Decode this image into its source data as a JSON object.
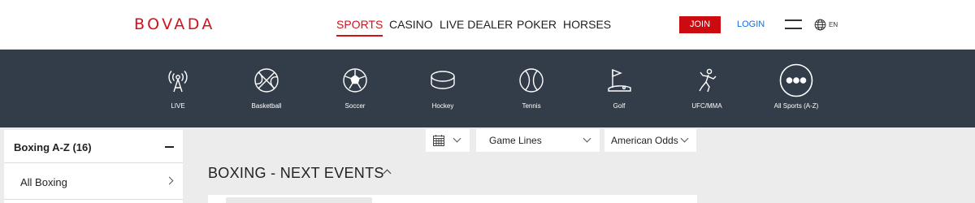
{
  "brand": {
    "logo_text": "BOVADA",
    "accent_color": "#d2121b"
  },
  "nav": {
    "items": [
      {
        "label": "SPORTS",
        "active": true
      },
      {
        "label": "CASINO",
        "active": false
      },
      {
        "label": "LIVE DEALER",
        "active": false
      },
      {
        "label": "POKER",
        "active": false
      },
      {
        "label": "HORSES",
        "active": false
      }
    ]
  },
  "header": {
    "join_label": "JOIN",
    "login_label": "LOGIN",
    "menu_icon": "hamburger-icon",
    "language": {
      "icon": "globe-icon",
      "label": "EN"
    }
  },
  "sports": [
    {
      "label": "LIVE",
      "icon": "live-broadcast-icon"
    },
    {
      "label": "Basketball",
      "icon": "basketball-icon"
    },
    {
      "label": "Soccer",
      "icon": "soccer-ball-icon"
    },
    {
      "label": "Hockey",
      "icon": "hockey-puck-icon"
    },
    {
      "label": "Tennis",
      "icon": "tennis-ball-icon"
    },
    {
      "label": "Golf",
      "icon": "golf-flag-icon"
    },
    {
      "label": "UFC/MMA",
      "icon": "fighter-icon"
    },
    {
      "label": "All Sports (A-Z)",
      "icon": "more-dots-icon"
    }
  ],
  "sidebar": {
    "header": "Boxing A-Z (16)",
    "items": [
      {
        "label": "All Boxing"
      }
    ]
  },
  "controls": {
    "calendar_icon": "calendar-icon",
    "market_select": "Game Lines",
    "odds_select": "American Odds"
  },
  "events": {
    "title": "BOXING - NEXT EVENTS"
  }
}
